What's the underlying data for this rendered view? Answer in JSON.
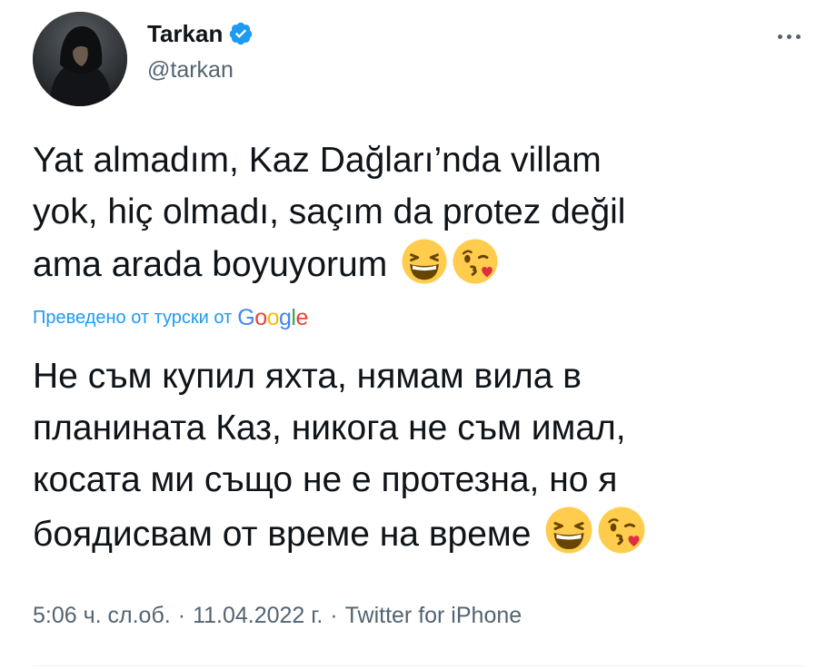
{
  "author": {
    "name": "Tarkan",
    "handle": "@tarkan",
    "verified": true
  },
  "tweet": {
    "original_lines": [
      "Yat almadım, Kaz Dağları’nda villam",
      "yok, hiç olmadı, saçım da protez değil",
      "ama arada boyuyorum"
    ],
    "translation_note": "Преведено от турски от",
    "translation_provider": "Google",
    "translated_lines": [
      "Не съм купил яхта, нямам вила в",
      "планината Каз, никога не съм имал,",
      "косата ми също не е протезна, но я",
      "боядисвам от време на време"
    ],
    "emojis": [
      "grinning-squinting-face",
      "face-blowing-a-kiss"
    ]
  },
  "meta": {
    "time": "5:06 ч. сл.об.",
    "separator": "·",
    "date": "11.04.2022 г.",
    "source": "Twitter for iPhone"
  },
  "colors": {
    "text": "#0f1419",
    "secondary": "#536471",
    "accent": "#1d9bf0",
    "verified": "#1d9bf0"
  }
}
